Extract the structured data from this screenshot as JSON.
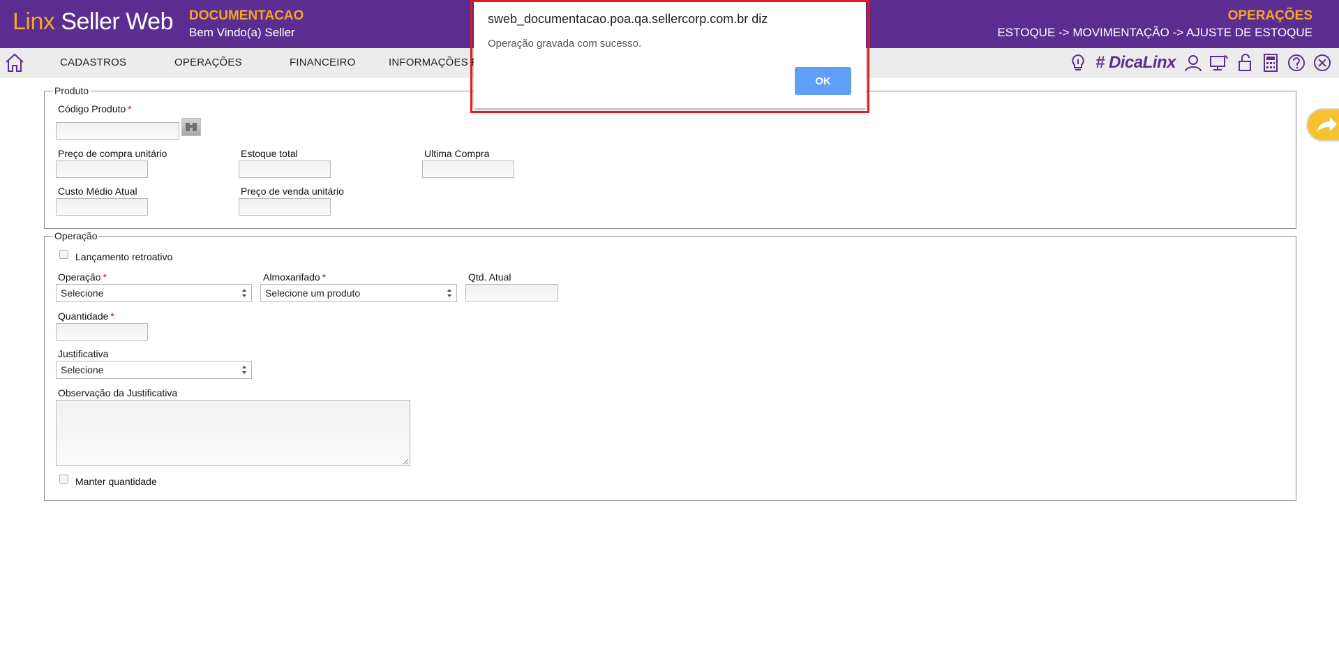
{
  "header": {
    "logo_linx": "Linx",
    "logo_rest": " Seller Web",
    "company": "DOCUMENTACAO",
    "welcome": "Bem Vindo(a) Seller",
    "section": "OPERAÇÕES",
    "breadcrumb": "ESTOQUE -> MOVIMENTAÇÃO -> AJUSTE DE ESTOQUE"
  },
  "menu": {
    "items": [
      "CADASTROS",
      "OPERAÇÕES",
      "FINANCEIRO",
      "INFORMAÇÕES FIS"
    ],
    "dica": "# DicaLinx",
    "icons": [
      "lightbulb-icon",
      "user-icon",
      "monitor-icon",
      "lock-icon",
      "calculator-icon",
      "help-icon",
      "close-icon"
    ]
  },
  "produto": {
    "legend": "Produto",
    "codigo_label": "Código Produto",
    "preco_compra_label": "Preço de compra unitário",
    "estoque_total_label": "Estoque total",
    "ultima_compra_label": "Ultima Compra",
    "custo_medio_label": "Custo Médio Atual",
    "preco_venda_label": "Preço de venda unitário"
  },
  "operacao": {
    "legend": "Operação",
    "retroativo_label": "Lançamento retroativo",
    "operacao_label": "Operação",
    "operacao_value": "Selecione",
    "almoxarifado_label": "Almoxarifado",
    "almoxarifado_value": "Selecione um produto",
    "qtd_atual_label": "Qtd. Atual",
    "quantidade_label": "Quantidade",
    "justificativa_label": "Justificativa",
    "justificativa_value": "Selecione",
    "observacao_label": "Observação da Justificativa",
    "manter_label": "Manter quantidade",
    "required_mark": "*"
  },
  "alert": {
    "title": "sweb_documentacao.poa.qa.sellercorp.com.br diz",
    "message": "Operação gravada com sucesso.",
    "ok_label": "OK"
  },
  "colors": {
    "brand_purple": "#5c2d91",
    "brand_orange": "#f5a623",
    "ok_blue": "#5ea0f5",
    "highlight_red": "#e31b1b"
  }
}
